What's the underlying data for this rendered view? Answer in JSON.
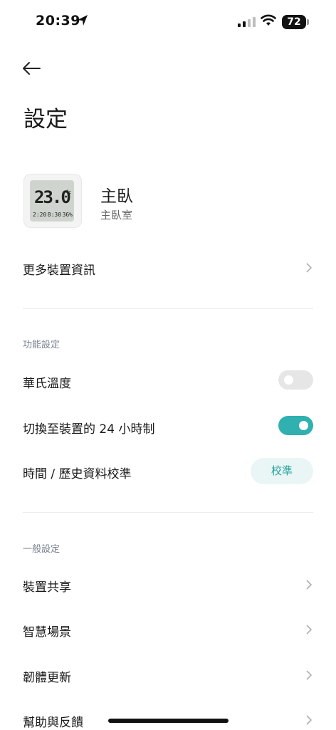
{
  "status_bar": {
    "time": "20:39",
    "battery": "72"
  },
  "header": {
    "title": "設定"
  },
  "device": {
    "name": "主臥",
    "room": "主臥室",
    "lcd_temp": "23.0",
    "lcd_unit": "°c",
    "lcd_time": "2:20",
    "lcd_mid": "8:30",
    "lcd_humidity": "36%"
  },
  "more_info": {
    "label": "更多裝置資訊"
  },
  "function_settings": {
    "title": "功能設定",
    "fahrenheit": {
      "label": "華氏溫度",
      "enabled": false
    },
    "clock24": {
      "label": "切換至裝置的 24 小時制",
      "enabled": true
    },
    "calibrate": {
      "label": "時間 / 歷史資料校準",
      "button": "校準"
    }
  },
  "general_settings": {
    "title": "一般設定",
    "items": [
      {
        "label": "裝置共享"
      },
      {
        "label": "智慧場景"
      },
      {
        "label": "韌體更新"
      },
      {
        "label": "幫助與反饋"
      }
    ]
  },
  "colors": {
    "accent": "#31b0b0",
    "toggle_off": "#e6e6e6",
    "button_bg": "#e9f6f5"
  }
}
